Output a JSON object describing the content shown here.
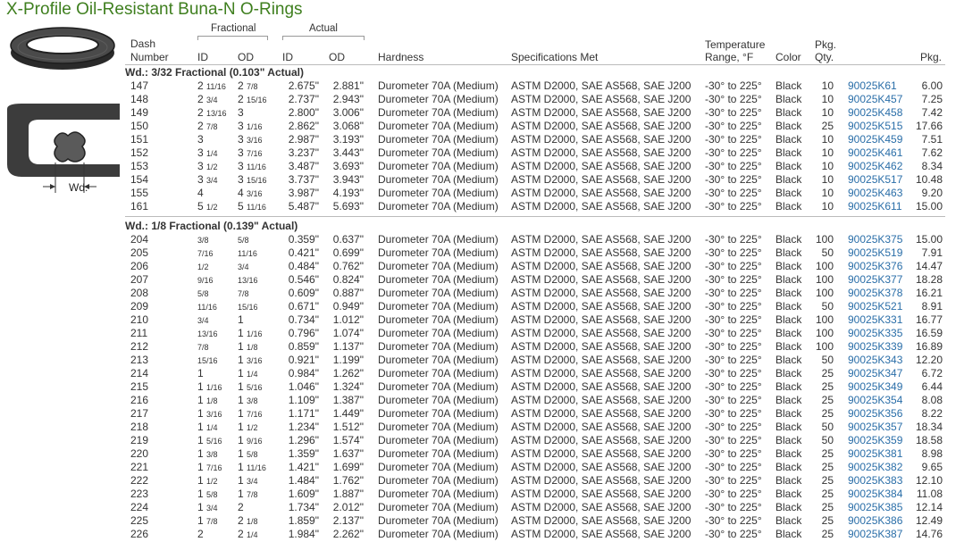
{
  "title": "X-Profile Oil-Resistant Buna-N O-Rings",
  "diagram_label": "Wd.",
  "header": {
    "fractional": "Fractional",
    "actual": "Actual",
    "dash": "Dash",
    "number": "Number",
    "id": "ID",
    "od": "OD",
    "hardness": "Hardness",
    "specs": "Specifications Met",
    "temp1": "Temperature",
    "temp2": "Range, °F",
    "color": "Color",
    "pkg1": "Pkg.",
    "qty": "Qty.",
    "pkg": "Pkg."
  },
  "sections": [
    {
      "title": "Wd.: 3/32 Fractional (0.103\" Actual)",
      "rows": [
        {
          "dash": "147",
          "fid_w": "2",
          "fid_f": "11/16",
          "fod_w": "2",
          "fod_f": "7/8",
          "aid": "2.675\"",
          "aod": "2.881\"",
          "hard": "Durometer 70A (Medium)",
          "spec": "ASTM D2000, SAE AS568, SAE J200",
          "temp": "-30° to 225°",
          "color": "Black",
          "qty": "10",
          "pn": "90025K61",
          "price": "6.00"
        },
        {
          "dash": "148",
          "fid_w": "2",
          "fid_f": "3/4",
          "fod_w": "2",
          "fod_f": "15/16",
          "aid": "2.737\"",
          "aod": "2.943\"",
          "hard": "Durometer 70A (Medium)",
          "spec": "ASTM D2000, SAE AS568, SAE J200",
          "temp": "-30° to 225°",
          "color": "Black",
          "qty": "10",
          "pn": "90025K457",
          "price": "7.25"
        },
        {
          "dash": "149",
          "fid_w": "2",
          "fid_f": "13/16",
          "fod_w": "3",
          "fod_f": "",
          "aid": "2.800\"",
          "aod": "3.006\"",
          "hard": "Durometer 70A (Medium)",
          "spec": "ASTM D2000, SAE AS568, SAE J200",
          "temp": "-30° to 225°",
          "color": "Black",
          "qty": "10",
          "pn": "90025K458",
          "price": "7.42"
        },
        {
          "dash": "150",
          "fid_w": "2",
          "fid_f": "7/8",
          "fod_w": "3",
          "fod_f": "1/16",
          "aid": "2.862\"",
          "aod": "3.068\"",
          "hard": "Durometer 70A (Medium)",
          "spec": "ASTM D2000, SAE AS568, SAE J200",
          "temp": "-30° to 225°",
          "color": "Black",
          "qty": "25",
          "pn": "90025K515",
          "price": "17.66"
        },
        {
          "dash": "151",
          "fid_w": "3",
          "fid_f": "",
          "fod_w": "3",
          "fod_f": "3/16",
          "aid": "2.987\"",
          "aod": "3.193\"",
          "hard": "Durometer 70A (Medium)",
          "spec": "ASTM D2000, SAE AS568, SAE J200",
          "temp": "-30° to 225°",
          "color": "Black",
          "qty": "10",
          "pn": "90025K459",
          "price": "7.51"
        },
        {
          "dash": "152",
          "fid_w": "3",
          "fid_f": "1/4",
          "fod_w": "3",
          "fod_f": "7/16",
          "aid": "3.237\"",
          "aod": "3.443\"",
          "hard": "Durometer 70A (Medium)",
          "spec": "ASTM D2000, SAE AS568, SAE J200",
          "temp": "-30° to 225°",
          "color": "Black",
          "qty": "10",
          "pn": "90025K461",
          "price": "7.62"
        },
        {
          "dash": "153",
          "fid_w": "3",
          "fid_f": "1/2",
          "fod_w": "3",
          "fod_f": "11/16",
          "aid": "3.487\"",
          "aod": "3.693\"",
          "hard": "Durometer 70A (Medium)",
          "spec": "ASTM D2000, SAE AS568, SAE J200",
          "temp": "-30° to 225°",
          "color": "Black",
          "qty": "10",
          "pn": "90025K462",
          "price": "8.34"
        },
        {
          "dash": "154",
          "fid_w": "3",
          "fid_f": "3/4",
          "fod_w": "3",
          "fod_f": "15/16",
          "aid": "3.737\"",
          "aod": "3.943\"",
          "hard": "Durometer 70A (Medium)",
          "spec": "ASTM D2000, SAE AS568, SAE J200",
          "temp": "-30° to 225°",
          "color": "Black",
          "qty": "10",
          "pn": "90025K517",
          "price": "10.48"
        },
        {
          "dash": "155",
          "fid_w": "4",
          "fid_f": "",
          "fod_w": "4",
          "fod_f": "3/16",
          "aid": "3.987\"",
          "aod": "4.193\"",
          "hard": "Durometer 70A (Medium)",
          "spec": "ASTM D2000, SAE AS568, SAE J200",
          "temp": "-30° to 225°",
          "color": "Black",
          "qty": "10",
          "pn": "90025K463",
          "price": "9.20"
        },
        {
          "dash": "161",
          "fid_w": "5",
          "fid_f": "1/2",
          "fod_w": "5",
          "fod_f": "11/16",
          "aid": "5.487\"",
          "aod": "5.693\"",
          "hard": "Durometer 70A (Medium)",
          "spec": "ASTM D2000, SAE AS568, SAE J200",
          "temp": "-30° to 225°",
          "color": "Black",
          "qty": "10",
          "pn": "90025K611",
          "price": "15.00"
        }
      ]
    },
    {
      "title": "Wd.: 1/8 Fractional (0.139\" Actual)",
      "rows": [
        {
          "dash": "204",
          "fid_w": "",
          "fid_f": "3/8",
          "fod_w": "",
          "fod_f": "5/8",
          "aid": "0.359\"",
          "aod": "0.637\"",
          "hard": "Durometer 70A (Medium)",
          "spec": "ASTM D2000, SAE AS568, SAE J200",
          "temp": "-30° to 225°",
          "color": "Black",
          "qty": "100",
          "pn": "90025K375",
          "price": "15.00"
        },
        {
          "dash": "205",
          "fid_w": "",
          "fid_f": "7/16",
          "fod_w": "",
          "fod_f": "11/16",
          "aid": "0.421\"",
          "aod": "0.699\"",
          "hard": "Durometer 70A (Medium)",
          "spec": "ASTM D2000, SAE AS568, SAE J200",
          "temp": "-30° to 225°",
          "color": "Black",
          "qty": "50",
          "pn": "90025K519",
          "price": "7.91"
        },
        {
          "dash": "206",
          "fid_w": "",
          "fid_f": "1/2",
          "fod_w": "",
          "fod_f": "3/4",
          "aid": "0.484\"",
          "aod": "0.762\"",
          "hard": "Durometer 70A (Medium)",
          "spec": "ASTM D2000, SAE AS568, SAE J200",
          "temp": "-30° to 225°",
          "color": "Black",
          "qty": "100",
          "pn": "90025K376",
          "price": "14.47"
        },
        {
          "dash": "207",
          "fid_w": "",
          "fid_f": "9/16",
          "fod_w": "",
          "fod_f": "13/16",
          "aid": "0.546\"",
          "aod": "0.824\"",
          "hard": "Durometer 70A (Medium)",
          "spec": "ASTM D2000, SAE AS568, SAE J200",
          "temp": "-30° to 225°",
          "color": "Black",
          "qty": "100",
          "pn": "90025K377",
          "price": "18.28"
        },
        {
          "dash": "208",
          "fid_w": "",
          "fid_f": "5/8",
          "fod_w": "",
          "fod_f": "7/8",
          "aid": "0.609\"",
          "aod": "0.887\"",
          "hard": "Durometer 70A (Medium)",
          "spec": "ASTM D2000, SAE AS568, SAE J200",
          "temp": "-30° to 225°",
          "color": "Black",
          "qty": "100",
          "pn": "90025K378",
          "price": "16.21"
        },
        {
          "dash": "209",
          "fid_w": "",
          "fid_f": "11/16",
          "fod_w": "",
          "fod_f": "15/16",
          "aid": "0.671\"",
          "aod": "0.949\"",
          "hard": "Durometer 70A (Medium)",
          "spec": "ASTM D2000, SAE AS568, SAE J200",
          "temp": "-30° to 225°",
          "color": "Black",
          "qty": "50",
          "pn": "90025K521",
          "price": "8.91"
        },
        {
          "dash": "210",
          "fid_w": "",
          "fid_f": "3/4",
          "fod_w": "1",
          "fod_f": "",
          "aid": "0.734\"",
          "aod": "1.012\"",
          "hard": "Durometer 70A (Medium)",
          "spec": "ASTM D2000, SAE AS568, SAE J200",
          "temp": "-30° to 225°",
          "color": "Black",
          "qty": "100",
          "pn": "90025K331",
          "price": "16.77"
        },
        {
          "dash": "211",
          "fid_w": "",
          "fid_f": "13/16",
          "fod_w": "1",
          "fod_f": "1/16",
          "aid": "0.796\"",
          "aod": "1.074\"",
          "hard": "Durometer 70A (Medium)",
          "spec": "ASTM D2000, SAE AS568, SAE J200",
          "temp": "-30° to 225°",
          "color": "Black",
          "qty": "100",
          "pn": "90025K335",
          "price": "16.59"
        },
        {
          "dash": "212",
          "fid_w": "",
          "fid_f": "7/8",
          "fod_w": "1",
          "fod_f": "1/8",
          "aid": "0.859\"",
          "aod": "1.137\"",
          "hard": "Durometer 70A (Medium)",
          "spec": "ASTM D2000, SAE AS568, SAE J200",
          "temp": "-30° to 225°",
          "color": "Black",
          "qty": "100",
          "pn": "90025K339",
          "price": "16.89"
        },
        {
          "dash": "213",
          "fid_w": "",
          "fid_f": "15/16",
          "fod_w": "1",
          "fod_f": "3/16",
          "aid": "0.921\"",
          "aod": "1.199\"",
          "hard": "Durometer 70A (Medium)",
          "spec": "ASTM D2000, SAE AS568, SAE J200",
          "temp": "-30° to 225°",
          "color": "Black",
          "qty": "50",
          "pn": "90025K343",
          "price": "12.20"
        },
        {
          "dash": "214",
          "fid_w": "1",
          "fid_f": "",
          "fod_w": "1",
          "fod_f": "1/4",
          "aid": "0.984\"",
          "aod": "1.262\"",
          "hard": "Durometer 70A (Medium)",
          "spec": "ASTM D2000, SAE AS568, SAE J200",
          "temp": "-30° to 225°",
          "color": "Black",
          "qty": "25",
          "pn": "90025K347",
          "price": "6.72"
        },
        {
          "dash": "215",
          "fid_w": "1",
          "fid_f": "1/16",
          "fod_w": "1",
          "fod_f": "5/16",
          "aid": "1.046\"",
          "aod": "1.324\"",
          "hard": "Durometer 70A (Medium)",
          "spec": "ASTM D2000, SAE AS568, SAE J200",
          "temp": "-30° to 225°",
          "color": "Black",
          "qty": "25",
          "pn": "90025K349",
          "price": "6.44"
        },
        {
          "dash": "216",
          "fid_w": "1",
          "fid_f": "1/8",
          "fod_w": "1",
          "fod_f": "3/8",
          "aid": "1.109\"",
          "aod": "1.387\"",
          "hard": "Durometer 70A (Medium)",
          "spec": "ASTM D2000, SAE AS568, SAE J200",
          "temp": "-30° to 225°",
          "color": "Black",
          "qty": "25",
          "pn": "90025K354",
          "price": "8.08"
        },
        {
          "dash": "217",
          "fid_w": "1",
          "fid_f": "3/16",
          "fod_w": "1",
          "fod_f": "7/16",
          "aid": "1.171\"",
          "aod": "1.449\"",
          "hard": "Durometer 70A (Medium)",
          "spec": "ASTM D2000, SAE AS568, SAE J200",
          "temp": "-30° to 225°",
          "color": "Black",
          "qty": "25",
          "pn": "90025K356",
          "price": "8.22"
        },
        {
          "dash": "218",
          "fid_w": "1",
          "fid_f": "1/4",
          "fod_w": "1",
          "fod_f": "1/2",
          "aid": "1.234\"",
          "aod": "1.512\"",
          "hard": "Durometer 70A (Medium)",
          "spec": "ASTM D2000, SAE AS568, SAE J200",
          "temp": "-30° to 225°",
          "color": "Black",
          "qty": "50",
          "pn": "90025K357",
          "price": "18.34"
        },
        {
          "dash": "219",
          "fid_w": "1",
          "fid_f": "5/16",
          "fod_w": "1",
          "fod_f": "9/16",
          "aid": "1.296\"",
          "aod": "1.574\"",
          "hard": "Durometer 70A (Medium)",
          "spec": "ASTM D2000, SAE AS568, SAE J200",
          "temp": "-30° to 225°",
          "color": "Black",
          "qty": "50",
          "pn": "90025K359",
          "price": "18.58"
        },
        {
          "dash": "220",
          "fid_w": "1",
          "fid_f": "3/8",
          "fod_w": "1",
          "fod_f": "5/8",
          "aid": "1.359\"",
          "aod": "1.637\"",
          "hard": "Durometer 70A (Medium)",
          "spec": "ASTM D2000, SAE AS568, SAE J200",
          "temp": "-30° to 225°",
          "color": "Black",
          "qty": "25",
          "pn": "90025K381",
          "price": "8.98"
        },
        {
          "dash": "221",
          "fid_w": "1",
          "fid_f": "7/16",
          "fod_w": "1",
          "fod_f": "11/16",
          "aid": "1.421\"",
          "aod": "1.699\"",
          "hard": "Durometer 70A (Medium)",
          "spec": "ASTM D2000, SAE AS568, SAE J200",
          "temp": "-30° to 225°",
          "color": "Black",
          "qty": "25",
          "pn": "90025K382",
          "price": "9.65"
        },
        {
          "dash": "222",
          "fid_w": "1",
          "fid_f": "1/2",
          "fod_w": "1",
          "fod_f": "3/4",
          "aid": "1.484\"",
          "aod": "1.762\"",
          "hard": "Durometer 70A (Medium)",
          "spec": "ASTM D2000, SAE AS568, SAE J200",
          "temp": "-30° to 225°",
          "color": "Black",
          "qty": "25",
          "pn": "90025K383",
          "price": "12.10"
        },
        {
          "dash": "223",
          "fid_w": "1",
          "fid_f": "5/8",
          "fod_w": "1",
          "fod_f": "7/8",
          "aid": "1.609\"",
          "aod": "1.887\"",
          "hard": "Durometer 70A (Medium)",
          "spec": "ASTM D2000, SAE AS568, SAE J200",
          "temp": "-30° to 225°",
          "color": "Black",
          "qty": "25",
          "pn": "90025K384",
          "price": "11.08"
        },
        {
          "dash": "224",
          "fid_w": "1",
          "fid_f": "3/4",
          "fod_w": "2",
          "fod_f": "",
          "aid": "1.734\"",
          "aod": "2.012\"",
          "hard": "Durometer 70A (Medium)",
          "spec": "ASTM D2000, SAE AS568, SAE J200",
          "temp": "-30° to 225°",
          "color": "Black",
          "qty": "25",
          "pn": "90025K385",
          "price": "12.14"
        },
        {
          "dash": "225",
          "fid_w": "1",
          "fid_f": "7/8",
          "fod_w": "2",
          "fod_f": "1/8",
          "aid": "1.859\"",
          "aod": "2.137\"",
          "hard": "Durometer 70A (Medium)",
          "spec": "ASTM D2000, SAE AS568, SAE J200",
          "temp": "-30° to 225°",
          "color": "Black",
          "qty": "25",
          "pn": "90025K386",
          "price": "12.49"
        },
        {
          "dash": "226",
          "fid_w": "2",
          "fid_f": "",
          "fod_w": "2",
          "fod_f": "1/4",
          "aid": "1.984\"",
          "aod": "2.262\"",
          "hard": "Durometer 70A (Medium)",
          "spec": "ASTM D2000, SAE AS568, SAE J200",
          "temp": "-30° to 225°",
          "color": "Black",
          "qty": "25",
          "pn": "90025K387",
          "price": "14.76"
        }
      ]
    }
  ]
}
